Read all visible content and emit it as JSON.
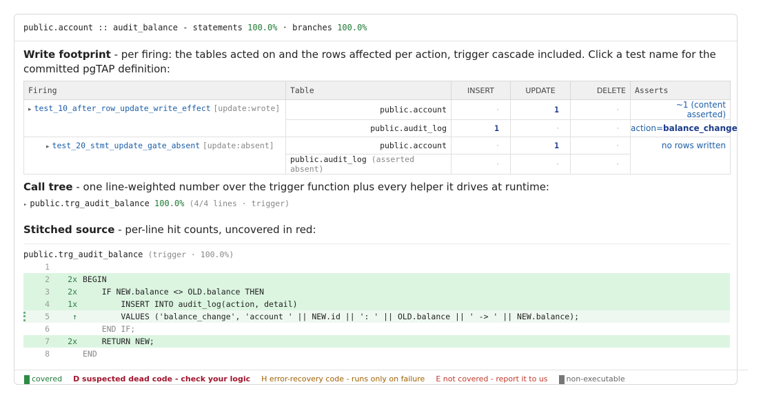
{
  "header": {
    "target": "public.account :: audit_balance",
    "sep1": " - statements ",
    "statements_pct": "100.0%",
    "sep2": " · branches ",
    "branches_pct": "100.0%"
  },
  "footprint": {
    "title": "Write footprint",
    "desc": " - per firing: the tables acted on and the rows affected per action, trigger cascade included. Click a test name for the committed pgTAP definition:",
    "columns": [
      "Firing",
      "Table",
      "INSERT",
      "UPDATE",
      "DELETE",
      "Asserts"
    ],
    "firings": [
      {
        "name": "test_10_after_row_update_write_effect",
        "tag": "[update:wrote]",
        "rows": [
          {
            "table": "public.account",
            "insert": "·",
            "update": "1",
            "delete": "·",
            "asserts": "~1 (content asserted)"
          },
          {
            "table": "public.audit_log",
            "insert": "1",
            "update": "·",
            "delete": "·",
            "asserts_key": "action=",
            "asserts_val": "balance_change"
          }
        ]
      },
      {
        "name": "test_20_stmt_update_gate_absent",
        "tag": "[update:absent]",
        "rows": [
          {
            "table": "public.account",
            "insert": "·",
            "update": "1",
            "delete": "·",
            "asserts": "no rows written"
          },
          {
            "table": "public.audit_log",
            "table_note": "(asserted absent)",
            "insert": "·",
            "update": "·",
            "delete": "·",
            "asserts": ""
          }
        ]
      }
    ]
  },
  "calltree": {
    "title": "Call tree",
    "desc": " - one line-weighted number over the trigger function plus every helper it drives at runtime:",
    "fn": "public.trg_audit_balance",
    "pct": "100.0%",
    "detail": "(4/4 lines · trigger)"
  },
  "source": {
    "title": "Stitched source",
    "desc": " - per-line hit counts, uncovered in red:",
    "fn": "public.trg_audit_balance",
    "detail": "(trigger · 100.0%)",
    "lines": [
      {
        "n": "1",
        "hits": "",
        "code": "",
        "state": "blank"
      },
      {
        "n": "2",
        "hits": "2x",
        "code": "BEGIN",
        "state": "cov"
      },
      {
        "n": "3",
        "hits": "2x",
        "code": "    IF NEW.balance <> OLD.balance THEN",
        "state": "cov"
      },
      {
        "n": "4",
        "hits": "1x",
        "code": "        INSERT INTO audit_log(action, detail)",
        "state": "cov"
      },
      {
        "n": "5",
        "hits": "↑",
        "code": "        VALUES ('balance_change', 'account ' || NEW.id || ': ' || OLD.balance || ' -> ' || NEW.balance);",
        "state": "cont"
      },
      {
        "n": "6",
        "hits": "",
        "code": "    END IF;",
        "state": "noexec"
      },
      {
        "n": "7",
        "hits": "2x",
        "code": "    RETURN NEW;",
        "state": "cov"
      },
      {
        "n": "8",
        "hits": "",
        "code": "END",
        "state": "noexec"
      }
    ]
  },
  "legend": {
    "covered": "covered",
    "dead": "D suspected dead code - check your logic",
    "error": "H error-recovery code - runs only on failure",
    "notcovered": "E not covered - report it to us",
    "nonexec": "non-executable",
    "colors": {
      "covered": "#2e8b47",
      "nonexec": "#777777"
    }
  }
}
